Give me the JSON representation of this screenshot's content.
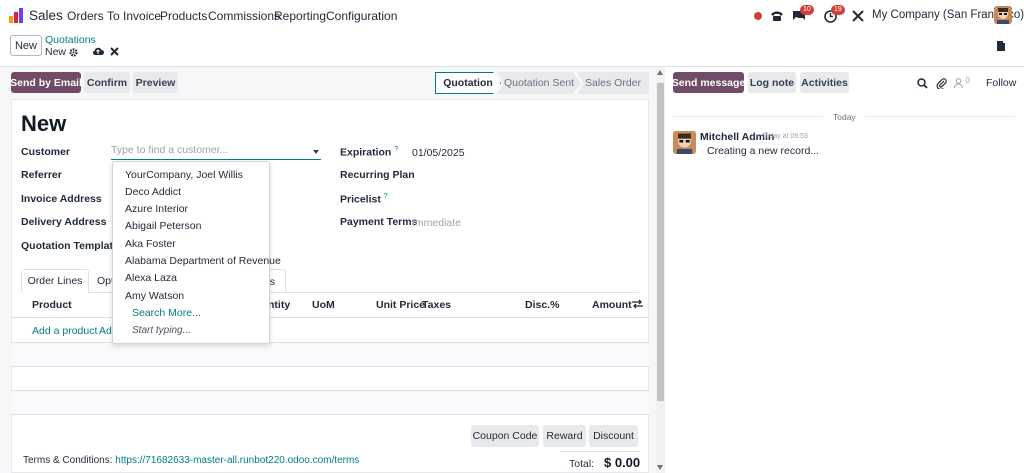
{
  "navbar": {
    "app_name": "Sales",
    "menu": [
      "Orders",
      "To Invoice",
      "Products",
      "Commissions",
      "Reporting",
      "Configuration"
    ],
    "messages_badge": "10",
    "activities_badge": "19",
    "company": "My Company (San Francisco)"
  },
  "control": {
    "new_label": "New",
    "breadcrumb_parent": "Quotations",
    "breadcrumb_current": "New"
  },
  "actions": {
    "send_by_email": "Send by Email",
    "confirm": "Confirm",
    "preview": "Preview"
  },
  "statusbar": [
    "Quotation",
    "Quotation Sent",
    "Sales Order"
  ],
  "form": {
    "title": "New",
    "customer_label": "Customer",
    "customer_placeholder": "Type to find a customer...",
    "referrer_label": "Referrer",
    "invoice_address_label": "Invoice Address",
    "delivery_address_label": "Delivery Address",
    "quotation_template_label": "Quotation Template",
    "expiration_label": "Expiration",
    "expiration_value": "01/05/2025",
    "recurring_plan_label": "Recurring Plan",
    "pricelist_label": "Pricelist",
    "payment_terms_label": "Payment Terms",
    "payment_terms_placeholder": "Immediate",
    "help_mark": "?"
  },
  "tabs": {
    "order_lines": "Order Lines",
    "optional_partial": "Opt",
    "other_partial": "s"
  },
  "table": {
    "headers": {
      "product": "Product",
      "quantity_partial": "ntity",
      "uom": "UoM",
      "unit_price": "Unit Price",
      "taxes": "Taxes",
      "disc": "Disc.%",
      "amount": "Amount"
    },
    "add_product": "Add a product",
    "add_section_partial": "Ad"
  },
  "dropdown": {
    "items": [
      "YourCompany, Joel Willis",
      "Deco Addict",
      "Azure Interior",
      "Abigail Peterson",
      "Aka Foster",
      "Alabama Department of Revenue",
      "Alexa Laza",
      "Amy Watson"
    ],
    "search_more": "Search More...",
    "start_typing": "Start typing..."
  },
  "footer": {
    "coupon_code": "Coupon Code",
    "reward": "Reward",
    "discount": "Discount",
    "terms_label": "Terms & Conditions:",
    "terms_url": "https://71682633-master-all.runbot220.odoo.com/terms",
    "total_label": "Total:",
    "total_value": "$ 0.00"
  },
  "chatter": {
    "send_message": "Send message",
    "log_note": "Log note",
    "activities": "Activities",
    "followers_count": "0",
    "follow": "Follow",
    "today": "Today",
    "author": "Mitchell Admin",
    "time": "Today at 09:53",
    "message": "Creating a new record..."
  },
  "colors": {
    "brand": "#714b67",
    "link": "#017e84",
    "badge": "#d23f3a"
  }
}
